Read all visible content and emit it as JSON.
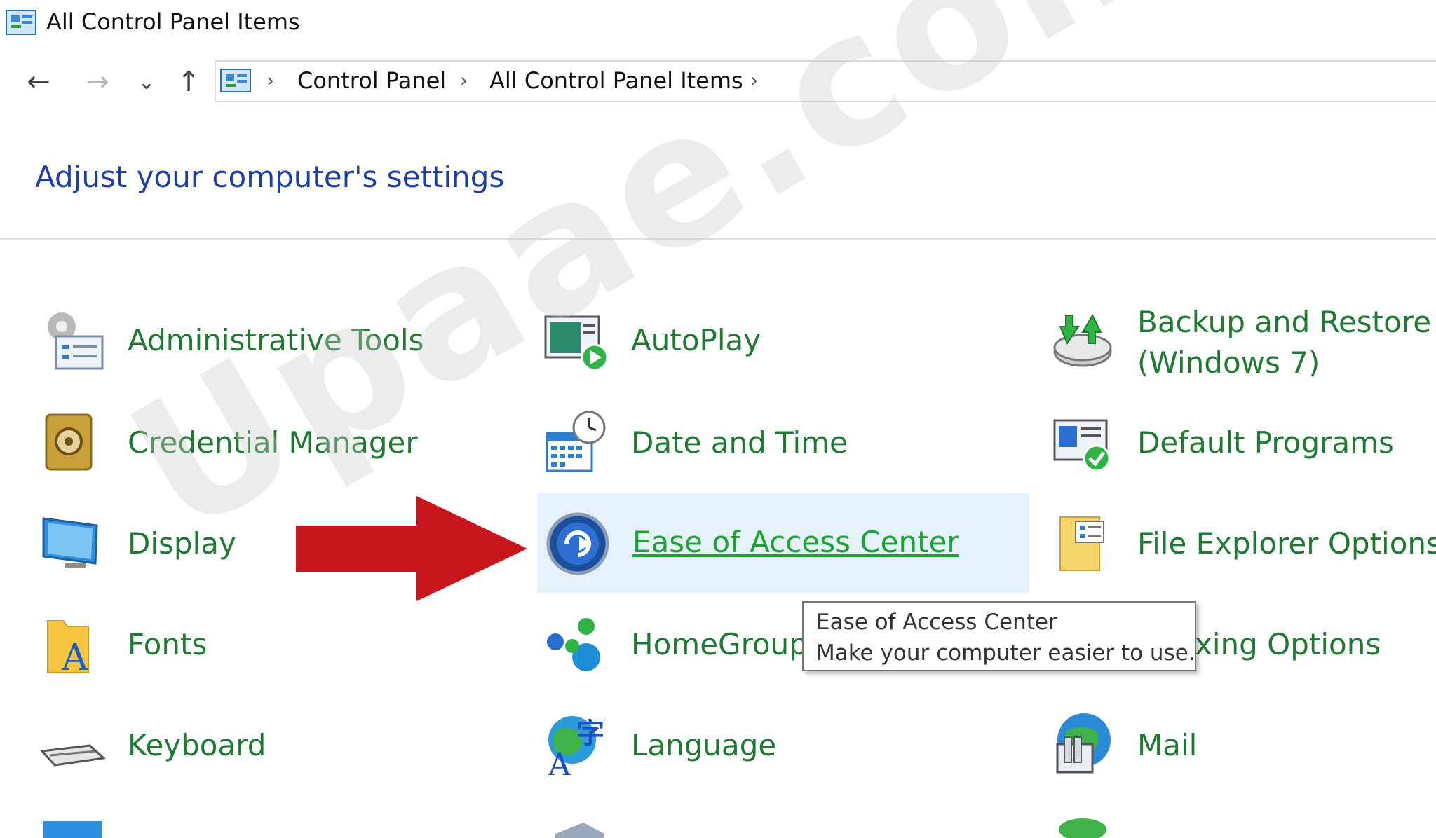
{
  "window": {
    "title": "All Control Panel Items"
  },
  "nav": {
    "back_glyph": "←",
    "forward_glyph": "→",
    "recent_glyph": "⌄",
    "up_glyph": "↑",
    "breadcrumb": [
      "Control Panel",
      "All Control Panel Items"
    ],
    "separator": "›"
  },
  "heading": "Adjust your computer's settings",
  "items": [
    {
      "label": "Administrative Tools",
      "icon": "admin-tools-icon"
    },
    {
      "label": "AutoPlay",
      "icon": "autoplay-icon"
    },
    {
      "label_line1": "Backup and Restore",
      "label_line2": "(Windows 7)",
      "icon": "backup-restore-icon"
    },
    {
      "label": "Credential Manager",
      "icon": "credential-manager-icon"
    },
    {
      "label": "Date and Time",
      "icon": "date-time-icon"
    },
    {
      "label": "Default Programs",
      "icon": "default-programs-icon"
    },
    {
      "label": "Display",
      "icon": "display-icon"
    },
    {
      "label": "Ease of Access Center",
      "icon": "ease-of-access-icon",
      "hovered": true
    },
    {
      "label": "File Explorer Options",
      "icon": "file-explorer-options-icon"
    },
    {
      "label": "Fonts",
      "icon": "fonts-icon"
    },
    {
      "label": "HomeGroup",
      "icon": "homegroup-icon"
    },
    {
      "label": "xing Options",
      "icon": "indexing-options-icon"
    },
    {
      "label": "Keyboard",
      "icon": "keyboard-icon"
    },
    {
      "label": "Language",
      "icon": "language-icon"
    },
    {
      "label": "Mail",
      "icon": "mail-icon"
    }
  ],
  "tooltip": {
    "title": "Ease of Access Center",
    "description": "Make your computer easier to use."
  },
  "watermark": "Upaae.com",
  "colors": {
    "link_green": "#1e7a32",
    "heading_blue": "#1e3fa0",
    "hover_bg": "#e5f1fb",
    "arrow_red": "#c8161d"
  }
}
